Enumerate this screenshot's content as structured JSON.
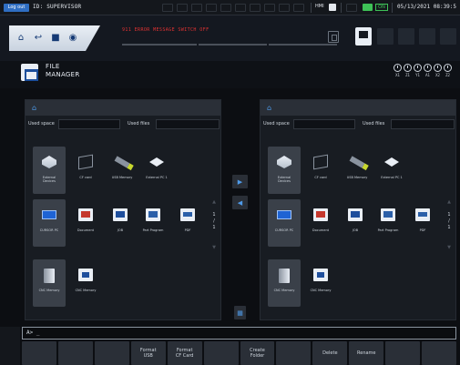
{
  "status_bar": {
    "login_label": "Log out",
    "user": "ID: SUPERVISOR",
    "hmi_label": "HMI",
    "on_label": "ON",
    "datetime": "05/13/2021 08:39:5"
  },
  "header": {
    "alarm_text": "911 ERROR MESSAGE SWITCH OFF",
    "nav_icons": [
      "home-icon",
      "back-icon",
      "lock-icon",
      "camera-icon"
    ]
  },
  "title": {
    "text": "FILE\nMANAGER"
  },
  "axes": [
    "X1",
    "Z1",
    "Y1",
    "A1",
    "X2",
    "Z2"
  ],
  "left_panel": {
    "used_space_label": "Used space",
    "used_files_label": "Used files",
    "tiles": [
      {
        "label": "External\nDevices",
        "icon": "external-devices-icon"
      },
      {
        "label": "CF card",
        "icon": "cf-card-icon"
      },
      {
        "label": "USB Memory",
        "icon": "usb-memory-icon"
      },
      {
        "label": "External PC 1",
        "icon": "external-pc-icon"
      },
      {
        "label": "CURSOR PC",
        "icon": "cursor-pc-icon"
      },
      {
        "label": "Document",
        "icon": "document-icon"
      },
      {
        "label": "JOB",
        "icon": "job-icon"
      },
      {
        "label": "Part Program",
        "icon": "part-program-icon"
      },
      {
        "label": "PDF",
        "icon": "pdf-icon"
      },
      {
        "label": "CNC Memory",
        "icon": "cnc-memory-icon"
      },
      {
        "label": "CNC Memory",
        "icon": "cnc-memory-folder-icon"
      }
    ],
    "page_indicator": "1\n/\n1"
  },
  "right_panel": {
    "used_space_label": "Used space",
    "used_files_label": "Used files",
    "tiles": [
      {
        "label": "External\nDevices",
        "icon": "external-devices-icon"
      },
      {
        "label": "CF card",
        "icon": "cf-card-icon"
      },
      {
        "label": "USB Memory",
        "icon": "usb-memory-icon"
      },
      {
        "label": "External PC 1",
        "icon": "external-pc-icon"
      },
      {
        "label": "CURSOR PC",
        "icon": "cursor-pc-icon"
      },
      {
        "label": "Document",
        "icon": "document-icon"
      },
      {
        "label": "JOB",
        "icon": "job-icon"
      },
      {
        "label": "Part Program",
        "icon": "part-program-icon"
      },
      {
        "label": "PDF",
        "icon": "pdf-icon"
      },
      {
        "label": "CNC Memory",
        "icon": "cnc-memory-icon"
      },
      {
        "label": "CNC Memory",
        "icon": "cnc-memory-folder-icon"
      }
    ],
    "page_indicator": "1\n/\n1"
  },
  "command_line": {
    "prompt": "A> _"
  },
  "softkeys": [
    "",
    "",
    "",
    "Format\nUSB",
    "Format\nCF Card",
    "",
    "Create\nFolder",
    "",
    "Delete",
    "Rename",
    "",
    ""
  ],
  "colors": {
    "accent": "#2f6ec2",
    "alarm": "#e13232",
    "ok": "#3ec157"
  }
}
